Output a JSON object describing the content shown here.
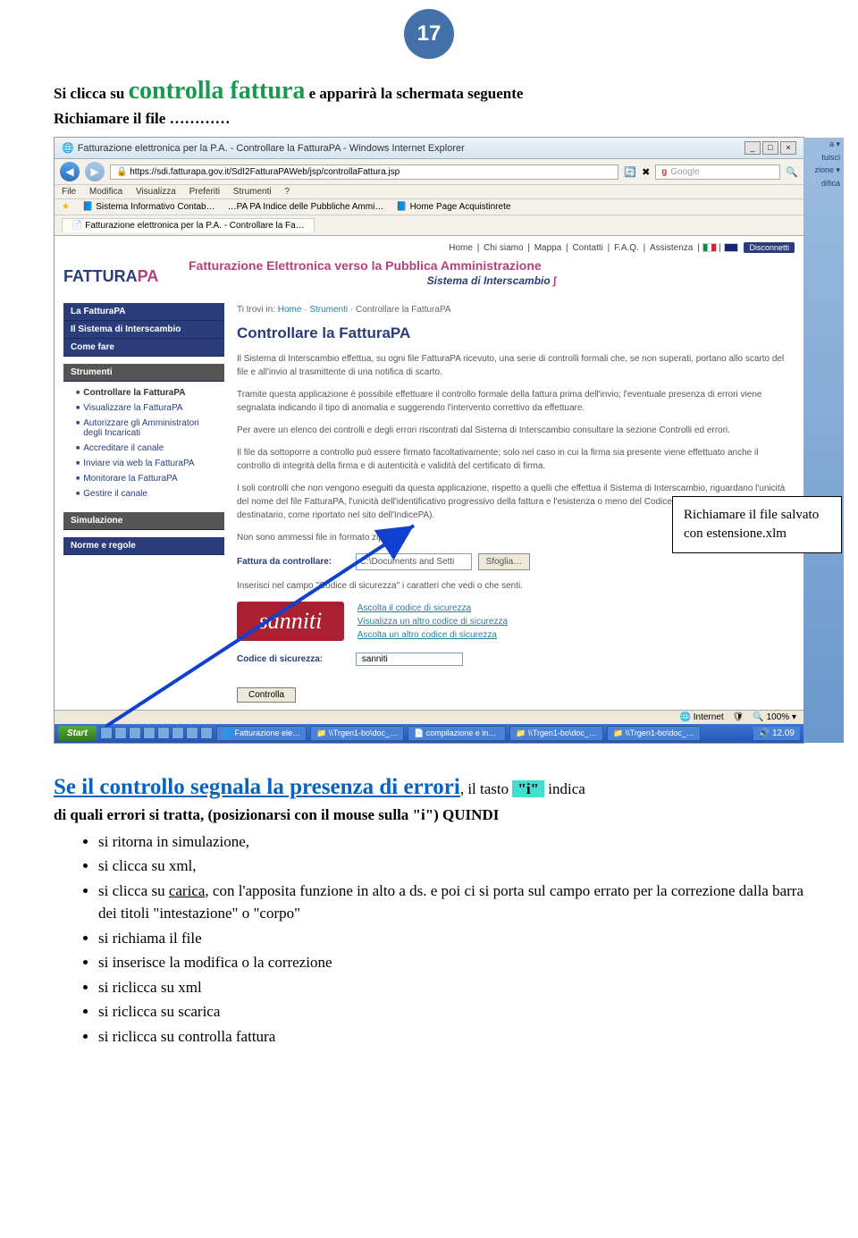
{
  "page_number": "17",
  "intro": {
    "pre": "Si clicca su ",
    "highlight": "controlla fattura",
    "post": " e apparirà la schermata seguente",
    "line2": "Richiamare il file …………"
  },
  "browser": {
    "title": "Fatturazione elettronica per la P.A. - Controllare la FatturaPA - Windows Internet Explorer",
    "url": "https://sdi.fatturapa.gov.it/SdI2FatturaPAWeb/jsp/controllaFattura.jsp",
    "search_placeholder": "Google",
    "menu": [
      "File",
      "Modifica",
      "Visualizza",
      "Preferiti",
      "Strumenti",
      "?"
    ],
    "favs": [
      "Sistema Informativo Contab…",
      "PA Indice delle Pubbliche Ammi…",
      "Home Page Acquistinrete"
    ],
    "tab": "Fatturazione elettronica per la P.A. - Controllare la Fa…",
    "edge_items": [
      "a ▾",
      "tuisci",
      "zione ▾",
      "difica"
    ]
  },
  "page": {
    "top_links": [
      "Home",
      "Chi siamo",
      "Mappa",
      "Contatti",
      "F.A.Q.",
      "Assistenza"
    ],
    "disconnect": "Disconnetti",
    "logo_main": "FATTURA",
    "logo_pa": "PA",
    "header_title": "Fatturazione Elettronica verso la Pubblica Amministrazione",
    "header_sub": "Sistema di Interscambio",
    "breadcrumb_pre": "Ti trovi in: ",
    "breadcrumb": [
      "Home",
      "Strumenti",
      "Controllare la FatturaPA"
    ],
    "h1": "Controllare la FatturaPA",
    "paras": [
      "Il Sistema di Interscambio effettua, su ogni file FatturaPA ricevuto, una serie di controlli formali che, se non superati, portano allo scarto del file e all'invio al trasmittente di una notifica di scarto.",
      "Tramite questa applicazione è possibile effettuare il controllo formale della fattura prima dell'invio; l'eventuale presenza di errori viene segnalata indicando il tipo di anomalia e suggerendo l'intervento correttivo da effettuare.",
      "Per avere un elenco dei controlli e degli errori riscontrati dal Sistema di Interscambio consultare la sezione Controlli ed errori.",
      "Il file da sottoporre a controllo può essere firmato facoltativamente; solo nel caso in cui la firma sia presente viene effettuato anche il controllo di integrità della firma e di autenticità e validità del certificato di firma.",
      "I soli controlli che non vengono eseguiti da questa applicazione, rispetto a quelli che effettua il Sistema di Interscambio, riguardano l'unicità del nome del file FatturaPA, l'unicità dell'identificativo progressivo della fattura e l'esistenza o meno del CodiceDestinatario (Codice Ufficio del destinatario, come riportato nel sito dell'IndicePA).",
      "Non sono ammessi file in formato zip."
    ],
    "file_label": "Fattura da controllare:",
    "file_value": "C:\\Documents and Setti",
    "browse_label": "Sfoglia…",
    "captcha_hint": "Inserisci nel campo \"Codice di sicurezza\" i caratteri che vedi o che senti.",
    "captcha_text": "sanniti",
    "captcha_links": [
      "Ascolta il codice di sicurezza",
      "Visualizza un altro codice di sicurezza",
      "Ascolta un altro codice di sicurezza"
    ],
    "security_label": "Codice di sicurezza:",
    "security_value": "sanniti",
    "submit_label": "Controlla",
    "sidebar": {
      "block1": [
        "La FatturaPA",
        "Il Sistema di Interscambio",
        "Come fare"
      ],
      "tools_head": "Strumenti",
      "tools_items": [
        "Controllare la FatturaPA",
        "Visualizzare la FatturaPA",
        "Autorizzare gli Amministratori degli Incaricati",
        "Accreditare il canale",
        "Inviare via web la FatturaPA",
        "Monitorare la FatturaPA",
        "Gestire il canale"
      ],
      "sim_head": "Simulazione",
      "norm_head": "Norme e regole"
    },
    "status": {
      "internet": "Internet",
      "zoom": "100%"
    }
  },
  "taskbar": {
    "start": "Start",
    "items": [
      "Fatturazione ele…",
      "\\\\Trgen1-bo\\doc_…",
      "compilazione e invi…",
      "\\\\Trgen1-bo\\doc_…",
      "\\\\Trgen1-bo\\doc_…"
    ],
    "time": "12.09"
  },
  "callout": "Richiamare il file salvato con estensione.xlm",
  "bottom": {
    "subhead_main": "Se il controllo segnala la presenza di errori",
    "subhead_tail1": ", il tasto ",
    "i_char": "\"i\"",
    "subhead_tail2": " indica",
    "line2": "di quali errori si tratta, (posizionarsi con il mouse sulla \"i\") QUINDI",
    "bullets": [
      {
        "text": "si ritorna in simulazione,"
      },
      {
        "text": "si clicca su xml,"
      },
      {
        "pre": "si clicca su ",
        "u": "carica",
        "post": ", con l'apposita funzione in alto a ds. e poi ci si porta sul campo errato per la correzione dalla barra dei titoli \"intestazione\" o \"corpo\""
      },
      {
        "text": "si richiama il file"
      },
      {
        "text": "si inserisce la modifica o la correzione"
      },
      {
        "text": "si riclicca su xml"
      },
      {
        "text": "si riclicca su scarica"
      },
      {
        "text": "si riclicca su controlla fattura"
      }
    ]
  }
}
